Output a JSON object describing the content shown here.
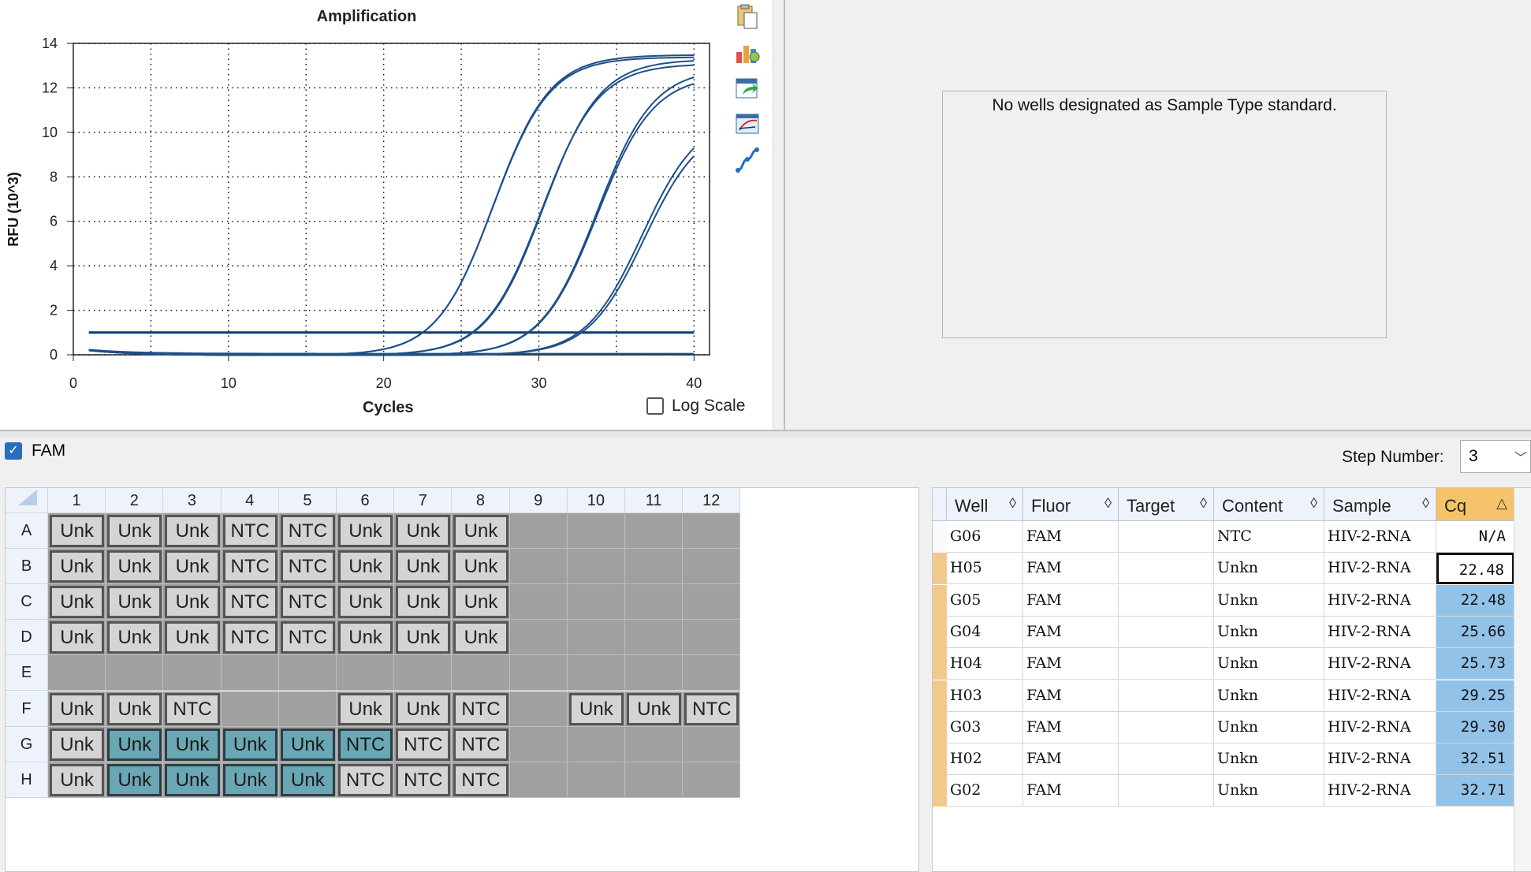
{
  "chart_data": {
    "type": "line",
    "title": "Amplification",
    "xlabel": "Cycles",
    "ylabel": "RFU (10^3)",
    "xlim": [
      0,
      41
    ],
    "ylim": [
      0,
      14
    ],
    "xticks": [
      0,
      10,
      20,
      30,
      40
    ],
    "yticks": [
      0,
      2,
      4,
      6,
      8,
      10,
      12,
      14
    ],
    "grid": true,
    "threshold": 1.0,
    "series": [
      {
        "cq": 22.48,
        "plateau": 13.4
      },
      {
        "cq": 22.48,
        "plateau": 13.5
      },
      {
        "cq": 25.66,
        "plateau": 13.1
      },
      {
        "cq": 25.73,
        "plateau": 13.3
      },
      {
        "cq": 29.25,
        "plateau": 12.9
      },
      {
        "cq": 29.3,
        "plateau": 12.6
      },
      {
        "cq": 32.51,
        "plateau": 10.8
      },
      {
        "cq": 32.71,
        "plateau": 10.5
      },
      {
        "cq": null,
        "plateau": 0
      }
    ]
  },
  "log_scale_label": "Log Scale",
  "toolbar": {
    "icons": [
      "copy-icon",
      "chart-settings-icon",
      "export-icon",
      "zoom-chart-icon",
      "curve-icon"
    ]
  },
  "standard_panel": {
    "message": "No wells designated as Sample Type standard."
  },
  "fluor_filter": {
    "label": "FAM",
    "checked": true
  },
  "step": {
    "label": "Step Number:",
    "value": "3"
  },
  "plate": {
    "columns": [
      "1",
      "2",
      "3",
      "4",
      "5",
      "6",
      "7",
      "8",
      "9",
      "10",
      "11",
      "12"
    ],
    "rows": [
      {
        "label": "A",
        "cells": [
          "Unk",
          "Unk",
          "Unk",
          "NTC",
          "NTC",
          "Unk",
          "Unk",
          "Unk",
          "",
          "",
          "",
          ""
        ]
      },
      {
        "label": "B",
        "cells": [
          "Unk",
          "Unk",
          "Unk",
          "NTC",
          "NTC",
          "Unk",
          "Unk",
          "Unk",
          "",
          "",
          "",
          ""
        ]
      },
      {
        "label": "C",
        "cells": [
          "Unk",
          "Unk",
          "Unk",
          "NTC",
          "NTC",
          "Unk",
          "Unk",
          "Unk",
          "",
          "",
          "",
          ""
        ]
      },
      {
        "label": "D",
        "cells": [
          "Unk",
          "Unk",
          "Unk",
          "NTC",
          "NTC",
          "Unk",
          "Unk",
          "Unk",
          "",
          "",
          "",
          ""
        ]
      },
      {
        "label": "E",
        "cells": [
          "",
          "",
          "",
          "",
          "",
          "",
          "",
          "",
          "",
          "",
          "",
          ""
        ]
      },
      {
        "label": "F",
        "cells": [
          "Unk",
          "Unk",
          "NTC",
          "",
          "",
          "Unk",
          "Unk",
          "NTC",
          "",
          "Unk",
          "Unk",
          "NTC"
        ]
      },
      {
        "label": "G",
        "cells": [
          "Unk",
          "Unk",
          "Unk",
          "Unk",
          "Unk",
          "NTC",
          "NTC",
          "NTC",
          "",
          "",
          "",
          ""
        ]
      },
      {
        "label": "H",
        "cells": [
          "Unk",
          "Unk",
          "Unk",
          "Unk",
          "Unk",
          "NTC",
          "NTC",
          "NTC",
          "",
          "",
          "",
          ""
        ]
      }
    ],
    "selected": {
      "G": [
        2,
        3,
        4,
        5,
        6
      ],
      "H": [
        2,
        3,
        4,
        5
      ]
    }
  },
  "table": {
    "headers": [
      "Well",
      "Fluor",
      "Target",
      "Content",
      "Sample",
      "Cq"
    ],
    "rows": [
      {
        "well": "G06",
        "fluor": "FAM",
        "target": "",
        "content": "NTC",
        "sample": "HIV-2-RNA",
        "cq": "N/A",
        "marker": false
      },
      {
        "well": "H05",
        "fluor": "FAM",
        "target": "",
        "content": "Unkn",
        "sample": "HIV-2-RNA",
        "cq": "22.48",
        "marker": true
      },
      {
        "well": "G05",
        "fluor": "FAM",
        "target": "",
        "content": "Unkn",
        "sample": "HIV-2-RNA",
        "cq": "22.48",
        "marker": true
      },
      {
        "well": "G04",
        "fluor": "FAM",
        "target": "",
        "content": "Unkn",
        "sample": "HIV-2-RNA",
        "cq": "25.66",
        "marker": true
      },
      {
        "well": "H04",
        "fluor": "FAM",
        "target": "",
        "content": "Unkn",
        "sample": "HIV-2-RNA",
        "cq": "25.73",
        "marker": true
      },
      {
        "well": "H03",
        "fluor": "FAM",
        "target": "",
        "content": "Unkn",
        "sample": "HIV-2-RNA",
        "cq": "29.25",
        "marker": true
      },
      {
        "well": "G03",
        "fluor": "FAM",
        "target": "",
        "content": "Unkn",
        "sample": "HIV-2-RNA",
        "cq": "29.30",
        "marker": true
      },
      {
        "well": "H02",
        "fluor": "FAM",
        "target": "",
        "content": "Unkn",
        "sample": "HIV-2-RNA",
        "cq": "32.51",
        "marker": true
      },
      {
        "well": "G02",
        "fluor": "FAM",
        "target": "",
        "content": "Unkn",
        "sample": "HIV-2-RNA",
        "cq": "32.71",
        "marker": true
      }
    ]
  }
}
